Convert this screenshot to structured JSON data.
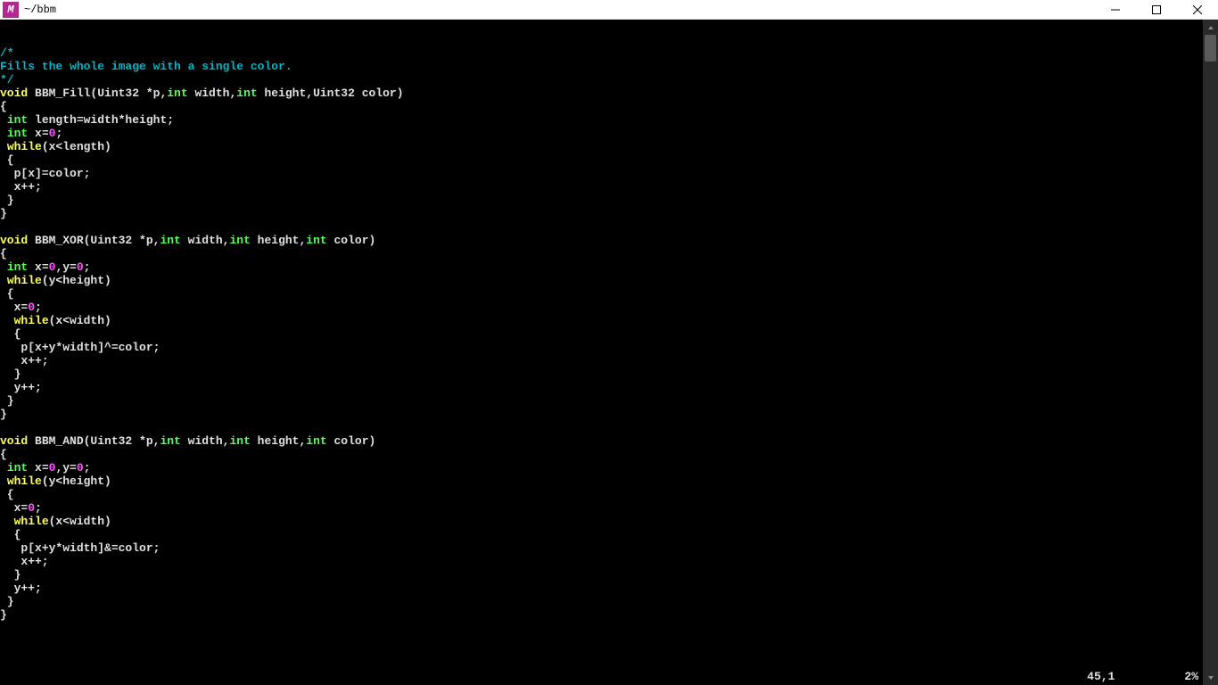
{
  "window": {
    "icon_letter": "M",
    "title": "~/bbm"
  },
  "status": {
    "position": "45,1",
    "percent": "2%"
  },
  "code": {
    "lines": [
      [
        [
          "comment",
          "/*"
        ]
      ],
      [
        [
          "comment",
          "Fills the whole image with a single color."
        ]
      ],
      [
        [
          "comment",
          "*/"
        ]
      ],
      [
        [
          "keyword",
          "void"
        ],
        [
          "plain",
          " BBM_Fill(Uint32 *p,"
        ],
        [
          "type",
          "int"
        ],
        [
          "plain",
          " width,"
        ],
        [
          "type",
          "int"
        ],
        [
          "plain",
          " height,Uint32 color)"
        ]
      ],
      [
        [
          "plain",
          "{"
        ]
      ],
      [
        [
          "plain",
          " "
        ],
        [
          "type",
          "int"
        ],
        [
          "plain",
          " length=width*height;"
        ]
      ],
      [
        [
          "plain",
          " "
        ],
        [
          "type",
          "int"
        ],
        [
          "plain",
          " x="
        ],
        [
          "number",
          "0"
        ],
        [
          "plain",
          ";"
        ]
      ],
      [
        [
          "plain",
          " "
        ],
        [
          "keyword",
          "while"
        ],
        [
          "plain",
          "(x<length)"
        ]
      ],
      [
        [
          "plain",
          " {"
        ]
      ],
      [
        [
          "plain",
          "  p[x]=color;"
        ]
      ],
      [
        [
          "plain",
          "  x++;"
        ]
      ],
      [
        [
          "plain",
          " }"
        ]
      ],
      [
        [
          "plain",
          "}"
        ]
      ],
      [
        [
          "plain",
          ""
        ]
      ],
      [
        [
          "keyword",
          "void"
        ],
        [
          "plain",
          " BBM_XOR(Uint32 *p,"
        ],
        [
          "type",
          "int"
        ],
        [
          "plain",
          " width,"
        ],
        [
          "type",
          "int"
        ],
        [
          "plain",
          " height,"
        ],
        [
          "type",
          "int"
        ],
        [
          "plain",
          " color)"
        ]
      ],
      [
        [
          "plain",
          "{"
        ]
      ],
      [
        [
          "plain",
          " "
        ],
        [
          "type",
          "int"
        ],
        [
          "plain",
          " x="
        ],
        [
          "number",
          "0"
        ],
        [
          "plain",
          ",y="
        ],
        [
          "number",
          "0"
        ],
        [
          "plain",
          ";"
        ]
      ],
      [
        [
          "plain",
          " "
        ],
        [
          "keyword",
          "while"
        ],
        [
          "plain",
          "(y<height)"
        ]
      ],
      [
        [
          "plain",
          " {"
        ]
      ],
      [
        [
          "plain",
          "  x="
        ],
        [
          "number",
          "0"
        ],
        [
          "plain",
          ";"
        ]
      ],
      [
        [
          "plain",
          "  "
        ],
        [
          "keyword",
          "while"
        ],
        [
          "plain",
          "(x<width)"
        ]
      ],
      [
        [
          "plain",
          "  {"
        ]
      ],
      [
        [
          "plain",
          "   p[x+y*width]^=color;"
        ]
      ],
      [
        [
          "plain",
          "   x++;"
        ]
      ],
      [
        [
          "plain",
          "  }"
        ]
      ],
      [
        [
          "plain",
          "  y++;"
        ]
      ],
      [
        [
          "plain",
          " }"
        ]
      ],
      [
        [
          "plain",
          "}"
        ]
      ],
      [
        [
          "plain",
          ""
        ]
      ],
      [
        [
          "keyword",
          "void"
        ],
        [
          "plain",
          " BBM_AND(Uint32 *p,"
        ],
        [
          "type",
          "int"
        ],
        [
          "plain",
          " width,"
        ],
        [
          "type",
          "int"
        ],
        [
          "plain",
          " height,"
        ],
        [
          "type",
          "int"
        ],
        [
          "plain",
          " color)"
        ]
      ],
      [
        [
          "plain",
          "{"
        ]
      ],
      [
        [
          "plain",
          " "
        ],
        [
          "type",
          "int"
        ],
        [
          "plain",
          " x="
        ],
        [
          "number",
          "0"
        ],
        [
          "plain",
          ",y="
        ],
        [
          "number",
          "0"
        ],
        [
          "plain",
          ";"
        ]
      ],
      [
        [
          "plain",
          " "
        ],
        [
          "keyword",
          "while"
        ],
        [
          "plain",
          "(y<height)"
        ]
      ],
      [
        [
          "plain",
          " {"
        ]
      ],
      [
        [
          "plain",
          "  x="
        ],
        [
          "number",
          "0"
        ],
        [
          "plain",
          ";"
        ]
      ],
      [
        [
          "plain",
          "  "
        ],
        [
          "keyword",
          "while"
        ],
        [
          "plain",
          "(x<width)"
        ]
      ],
      [
        [
          "plain",
          "  {"
        ]
      ],
      [
        [
          "plain",
          "   p[x+y*width]&=color;"
        ]
      ],
      [
        [
          "plain",
          "   x++;"
        ]
      ],
      [
        [
          "plain",
          "  }"
        ]
      ],
      [
        [
          "plain",
          "  y++;"
        ]
      ],
      [
        [
          "plain",
          " }"
        ]
      ],
      [
        [
          "plain",
          "}"
        ]
      ]
    ]
  }
}
